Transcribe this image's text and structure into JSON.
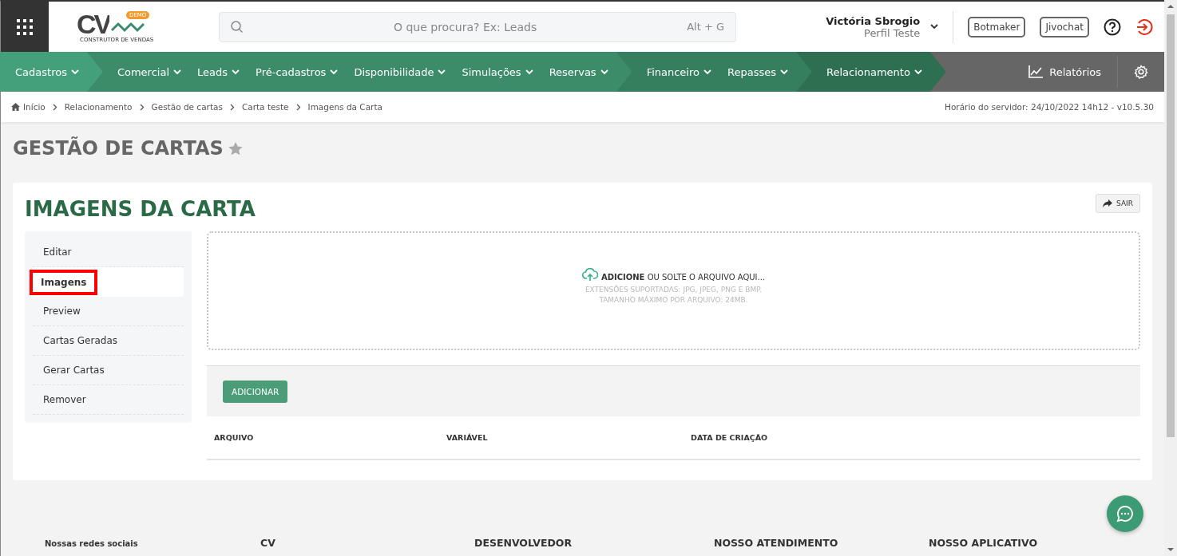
{
  "header": {
    "logo": {
      "mark": "CV",
      "badge": "DEMO",
      "tagline": "CONSTRUTOR DE VENDAS"
    },
    "search": {
      "placeholder": "O que procura? Ex: Leads",
      "shortcut": "Alt + G"
    },
    "user": {
      "name": "Victória Sbrogio",
      "profile": "Perfil Teste"
    },
    "buttons": [
      "Botmaker",
      "Jivochat"
    ]
  },
  "nav": {
    "groups": [
      {
        "color": "#44a07a",
        "items": [
          "Cadastros"
        ]
      },
      {
        "color": "#3c8c69",
        "items": [
          "Comercial",
          "Leads",
          "Pré-cadastros",
          "Disponibilidade",
          "Simulações",
          "Reservas"
        ]
      },
      {
        "color": "#357f5e",
        "items": [
          "Financeiro",
          "Repasses"
        ]
      },
      {
        "color": "#2e6f51",
        "items": [
          "Relacionamento"
        ]
      }
    ],
    "reports": "Relatórios"
  },
  "breadcrumb": {
    "items": [
      "Início",
      "Relacionamento",
      "Gestão de cartas",
      "Carta teste",
      "Imagens da Carta"
    ],
    "server_time": "Horário do servidor: 24/10/2022 14h12 - v10.5.30"
  },
  "page_title": "GESTÃO DE CARTAS",
  "card": {
    "title": "IMAGENS DA CARTA",
    "exit_button": "SAIR",
    "menu": [
      {
        "label": "Editar",
        "selected": false
      },
      {
        "label": "Imagens",
        "selected": true
      },
      {
        "label": "Preview",
        "selected": false
      },
      {
        "label": "Cartas Geradas",
        "selected": false
      },
      {
        "label": "Gerar Cartas",
        "selected": false
      },
      {
        "label": "Remover",
        "selected": false
      }
    ],
    "dropzone": {
      "prompt": "**ADICIONE** OU SOLTE O ARQUIVO AQUI...",
      "hints": [
        "EXTENSÕES SUPORTADAS: JPG, JPEG, PNG E BMP.",
        "TAMANHO MÁXIMO POR ARQUIVO: 24MB."
      ]
    },
    "add_button": "ADICIONAR",
    "table": {
      "columns": [
        "ARQUIVO",
        "VARIÁVEL",
        "DATA DE CRIAÇÃO"
      ]
    }
  },
  "footer": {
    "columns": [
      "Nossas redes sociais",
      "CV",
      "DESENVOLVEDOR",
      "NOSSO ATENDIMENTO",
      "NOSSO APLICATIVO"
    ]
  }
}
